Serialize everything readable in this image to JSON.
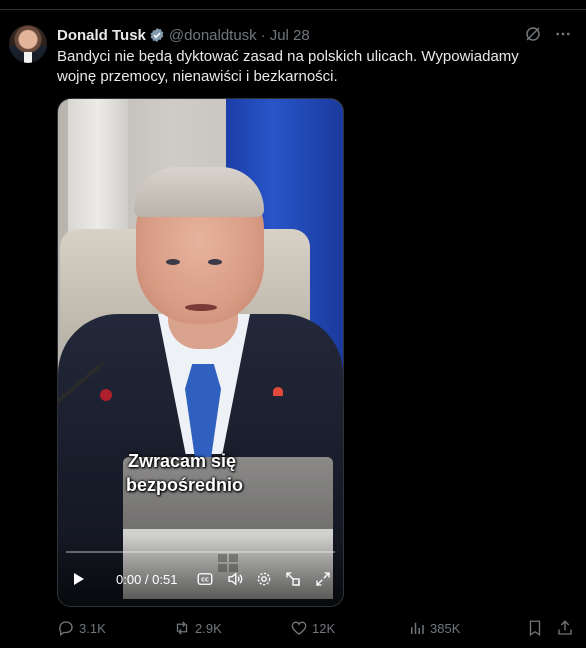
{
  "tweet": {
    "author_name": "Donald Tusk",
    "handle": "@donaldtusk",
    "separator": "·",
    "date": "Jul 28",
    "text": "Bandyci nie będą dyktować zasad na polskich ulicach. Wypowiadamy wojnę przemocy, nienawiści i bezkarności."
  },
  "video": {
    "caption_line1": "Zwracam się",
    "caption_line2": "bezpośrednio",
    "time": "0:00 / 0:51",
    "progress": 0
  },
  "stats": {
    "replies": "3.1K",
    "reposts": "2.9K",
    "likes": "12K",
    "views": "385K"
  },
  "icons": [
    "verified-badge-icon",
    "grok-icon",
    "more-icon",
    "play-icon",
    "closed-captions-icon",
    "volume-icon",
    "settings-icon",
    "pip-icon",
    "fullscreen-icon",
    "reply-icon",
    "repost-icon",
    "like-icon",
    "views-icon",
    "bookmark-icon",
    "share-icon"
  ],
  "colors": {
    "background": "#000000",
    "text": "#e7e9ea",
    "muted": "#71767b",
    "accent": "#1d9bf0"
  }
}
